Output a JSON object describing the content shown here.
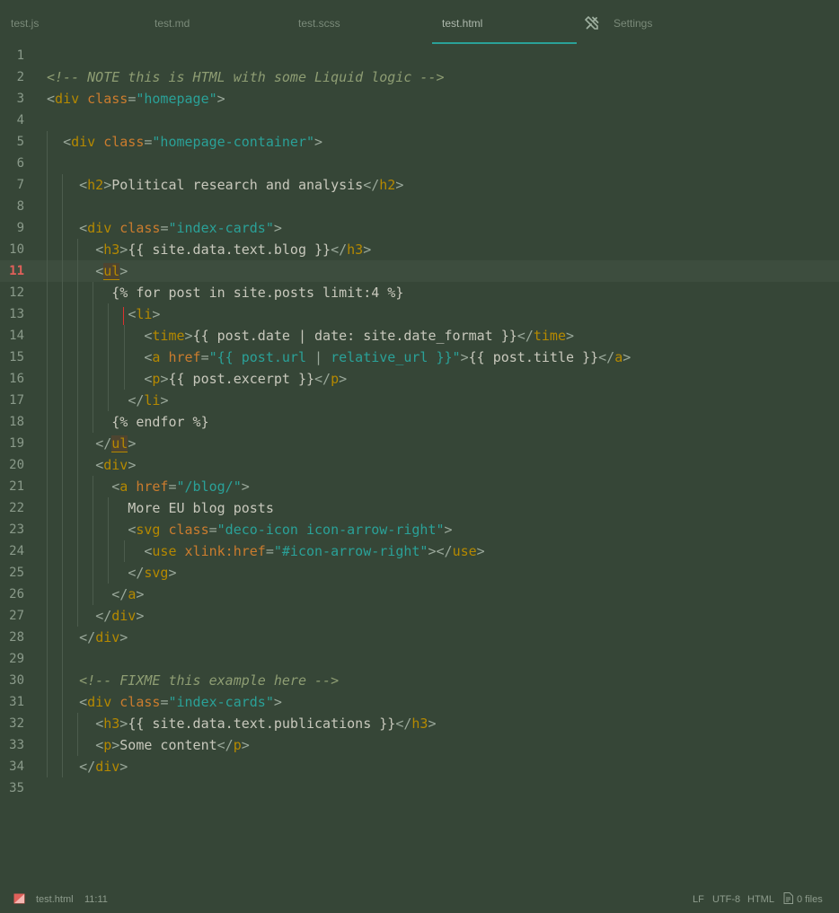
{
  "tabs": [
    {
      "label": "test.js",
      "active": false
    },
    {
      "label": "test.md",
      "active": false
    },
    {
      "label": "test.scss",
      "active": false
    },
    {
      "label": "test.html",
      "active": true
    },
    {
      "label": "Settings",
      "active": false,
      "icon": "tools-icon"
    }
  ],
  "editor": {
    "current_line": 11,
    "lines": [
      "",
      "<!-- NOTE this is HTML with some Liquid logic -->",
      "<div class=\"homepage\">",
      "",
      "  <div class=\"homepage-container\">",
      "",
      "    <h2>Political research and analysis</h2>",
      "",
      "    <div class=\"index-cards\">",
      "      <h3>{{ site.data.text.blog }}</h3>",
      "      <ul>",
      "        {% for post in site.posts limit:4 %}",
      "          <li>",
      "            <time>{{ post.date | date: site.date_format }}</time>",
      "            <a href=\"{{ post.url | relative_url }}\">{{ post.title }}</a>",
      "            <p>{{ post.excerpt }}</p>",
      "          </li>",
      "        {% endfor %}",
      "      </ul>",
      "      <div>",
      "        <a href=\"/blog/\">",
      "          More EU blog posts",
      "          <svg class=\"deco-icon icon-arrow-right\">",
      "            <use xlink:href=\"#icon-arrow-right\"></use>",
      "          </svg>",
      "        </a>",
      "      </div>",
      "    </div>",
      "",
      "    <!-- FIXME this example here -->",
      "    <div class=\"index-cards\">",
      "      <h3>{{ site.data.text.publications }}</h3>",
      "      <p>Some content</p>",
      "    </div>",
      ""
    ]
  },
  "statusbar": {
    "error_icon": "error-icon",
    "file_name": "test.html",
    "cursor_position": "11:11",
    "line_ending": "LF",
    "encoding": "UTF-8",
    "language": "HTML",
    "files_icon": "files-icon",
    "files": "0 files"
  },
  "colors": {
    "background": "#364637",
    "accent": "#2aa198",
    "tag": "#b58900",
    "attribute": "#cb7c2e",
    "string": "#2aa198",
    "comment": "#8e9d73",
    "current_line_number": "#e0605a"
  }
}
